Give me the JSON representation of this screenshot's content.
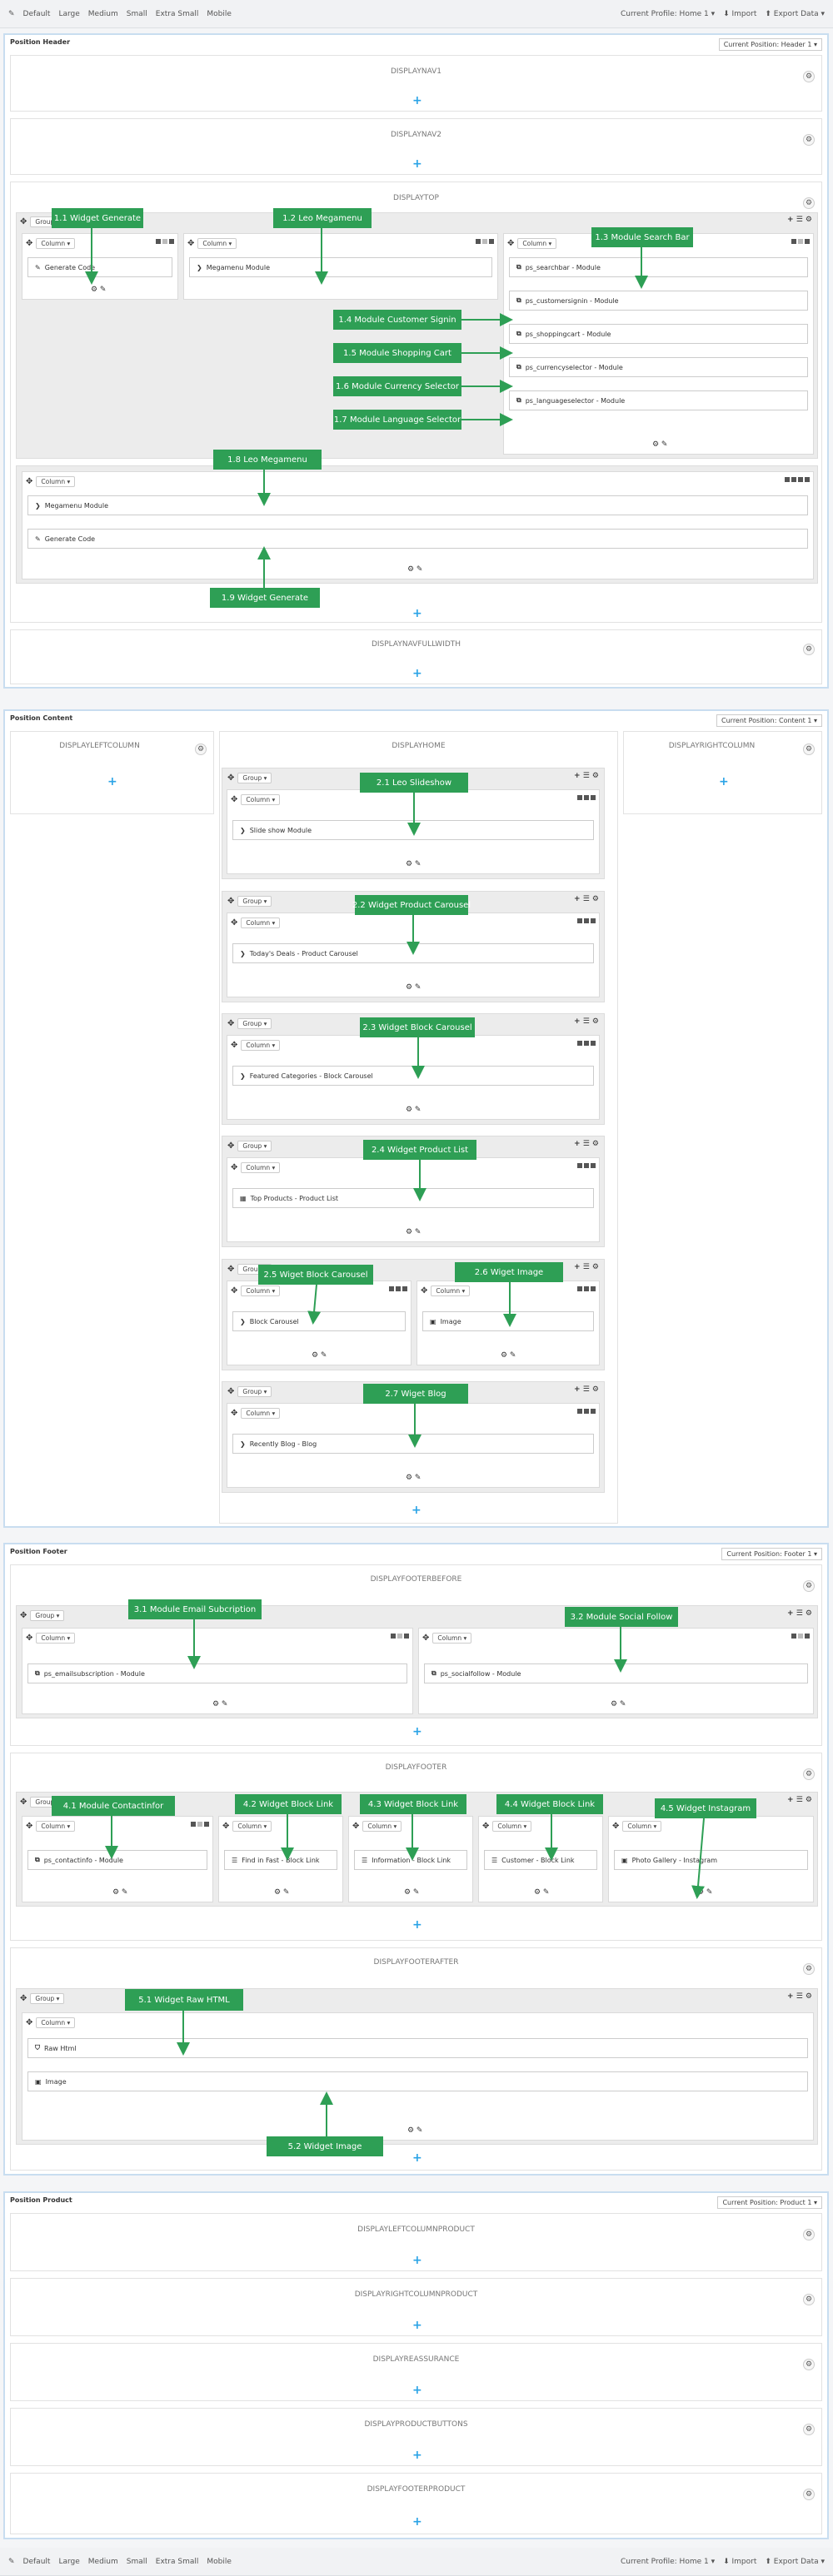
{
  "toolbar": {
    "items": [
      "Default",
      "Large",
      "Medium",
      "Small",
      "Extra Small",
      "Mobile"
    ],
    "profile": "Current Profile: Home 1 ▾",
    "import": "Import",
    "export": "Export Data ▾"
  },
  "ui": {
    "group": "Group ▾",
    "column": "Column ▾",
    "plus": "+",
    "gear": "⚙",
    "edit": "✎",
    "move": "✥"
  },
  "header": {
    "title": "Position Header",
    "select": "Current Position: Header 1 ▾",
    "hooks": {
      "nav1": "DISPLAYNAV1",
      "nav2": "DISPLAYNAV2",
      "top": "DISPLAYTOP",
      "navfull": "DISPLAYNAVFULLWIDTH"
    },
    "modules": {
      "generate": "Generate Code",
      "megamenu": "Megamenu Module",
      "search": "ps_searchbar - Module",
      "signin": "ps_customersignin - Module",
      "cart": "ps_shoppingcart - Module",
      "currency": "ps_currencyselector - Module",
      "language": "ps_languageselector - Module",
      "megamenu2": "Megamenu Module",
      "generate2": "Generate Code"
    }
  },
  "content": {
    "title": "Position Content",
    "select": "Current Position: Content 1 ▾",
    "hooks": {
      "left": "DISPLAYLEFTCOLUMN",
      "home": "DISPLAYHOME",
      "right": "DISPLAYRIGHTCOLUMN"
    },
    "modules": {
      "slideshow": "Slide show Module",
      "deals": "Today's Deals - Product Carousel",
      "featured": "Featured Categories - Block Carousel",
      "topproducts": "Top Products - Product List",
      "blockcarousel": "Block Carousel",
      "image": "Image",
      "blog": "Recently Blog - Blog"
    }
  },
  "footer": {
    "title": "Position Footer",
    "select": "Current Position: Footer 1 ▾",
    "hooks": {
      "before": "DISPLAYFOOTERBEFORE",
      "footer": "DISPLAYFOOTER",
      "after": "DISPLAYFOOTERAFTER"
    },
    "modules": {
      "email": "ps_emailsubscription - Module",
      "social": "ps_socialfollow - Module",
      "contact": "ps_contactinfo - Module",
      "fast": "Find in Fast - Block Link",
      "info": "Information - Block Link",
      "customer": "Customer - Block Link",
      "gallery": "Photo Gallery - Instagram",
      "raw": "Raw Html",
      "image": "Image"
    }
  },
  "product": {
    "title": "Position Product",
    "select": "Current Position: Product 1 ▾",
    "hooks": {
      "left": "DISPLAYLEFTCOLUMNPRODUCT",
      "right": "DISPLAYRIGHTCOLUMNPRODUCT",
      "reassurance": "DISPLAYREASSURANCE",
      "buttons": "DISPLAYPRODUCTBUTTONS",
      "footer": "DISPLAYFOOTERPRODUCT"
    }
  },
  "labels": {
    "l11": "1.1 Widget Generate",
    "l12": "1.2 Leo Megamenu",
    "l13": "1.3 Module Search Bar",
    "l14": "1.4 Module Customer Signin",
    "l15": "1.5 Module Shopping Cart",
    "l16": "1.6 Module Currency Selector",
    "l17": "1.7 Module Language Selector",
    "l18": "1.8  Leo Megamenu",
    "l19": "1.9 Widget Generate",
    "l21": "2.1 Leo Slideshow",
    "l22": "2.2 Widget Product Carousel",
    "l23": "2.3 Widget Block Carousel",
    "l24": "2.4 Widget Product List",
    "l25": "2.5 Wiget Block Carousel",
    "l26": "2.6 Wiget Image",
    "l27": "2.7 Wiget Blog",
    "l31": "3.1 Module Email Subcription",
    "l32": "3.2 Module Social Follow",
    "l41": "4.1 Module Contactinfor",
    "l42": "4.2 Widget Block Link",
    "l43": "4.3 Widget Block Link",
    "l44": "4.4 Widget Block Link",
    "l45": "4.5 Widget Instagram",
    "l51": "5.1 Widget Raw HTML",
    "l52": "5.2 Widget Image"
  },
  "colors": {
    "label": "#2e9f55",
    "plus": "#2aa3e6",
    "border": "#c8ddf0"
  }
}
